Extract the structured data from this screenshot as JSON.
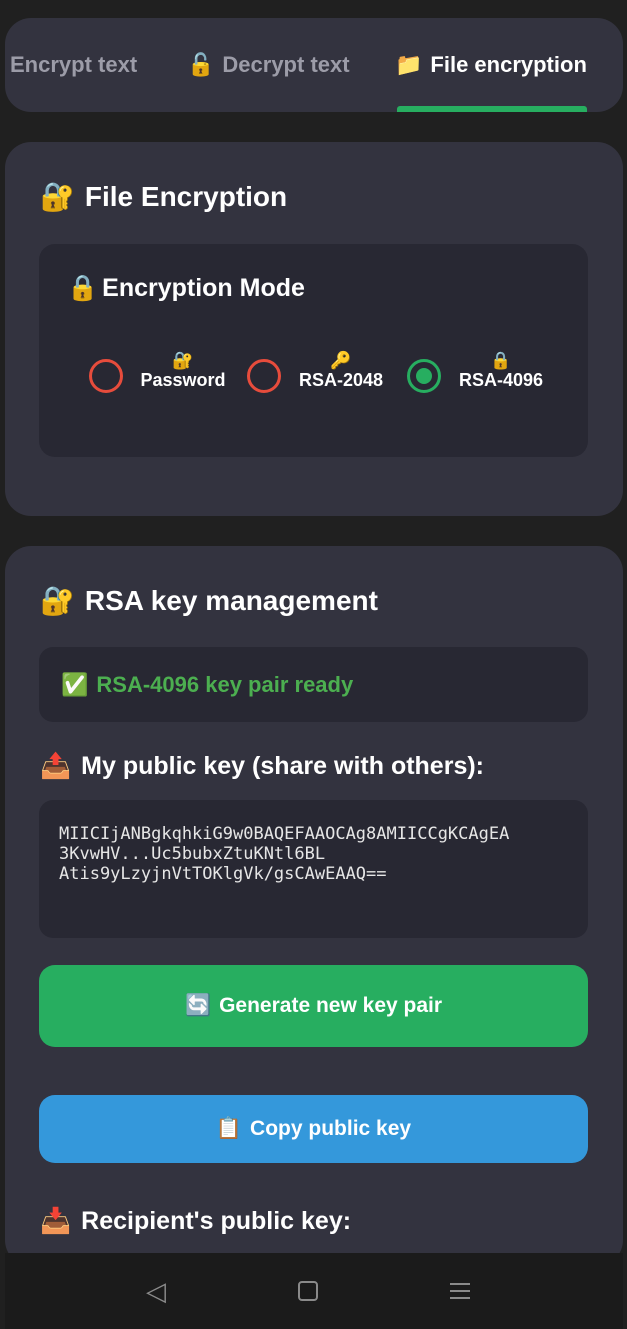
{
  "tabs": [
    {
      "icon": "",
      "label": "Encrypt text"
    },
    {
      "icon": "🔓",
      "label": "Decrypt text"
    },
    {
      "icon": "📁",
      "label": "File encryption"
    }
  ],
  "file_card": {
    "icon": "🔐",
    "title": "File Encryption",
    "mode": {
      "icon": "🔒",
      "title": "Encryption Mode",
      "options": [
        {
          "icon": "🔐",
          "label": "Password",
          "selected": false
        },
        {
          "icon": "🔑",
          "label": "RSA-2048",
          "selected": false
        },
        {
          "icon": "🔒",
          "label": "RSA-4096",
          "selected": true
        }
      ]
    }
  },
  "rsa_card": {
    "icon": "🔐",
    "title": "RSA key management",
    "status": {
      "icon": "✅",
      "text": "RSA-4096 key pair ready",
      "color": "#4caf50"
    },
    "public_key_label": {
      "icon": "📤",
      "text": "My public key (share with others):"
    },
    "public_key_value": "MIICIjANBgkqhkiG9w0BAQEFAAOCAg8AMIICCgKCAgEA\n3KvwHV...Uc5bubxZtuKNtl6BL\nAtis9yLzyjnVtTOKlgVk/gsCAwEAAQ==",
    "generate_button": {
      "icon": "🔄",
      "label": "Generate new key pair",
      "color": "#27ae60"
    },
    "copy_button": {
      "icon": "📋",
      "label": "Copy public key",
      "color": "#3498db"
    },
    "recipient_label": {
      "icon": "📥",
      "text": "Recipient's public key:"
    }
  },
  "navbar": {
    "back_glyph": "◁"
  }
}
